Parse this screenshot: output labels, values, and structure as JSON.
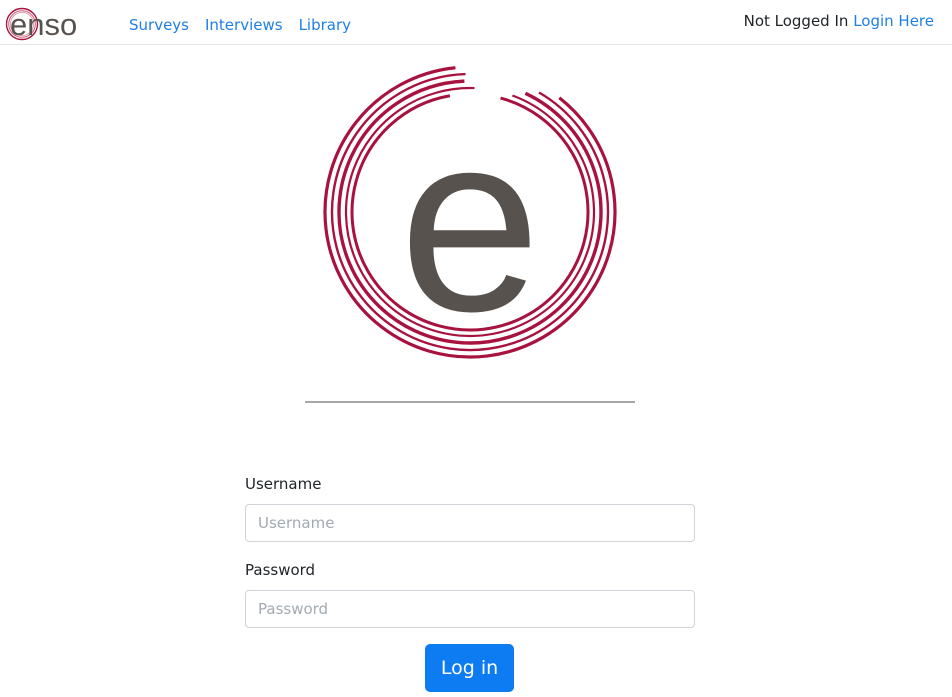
{
  "brand": {
    "name": "enso"
  },
  "nav": {
    "links": [
      {
        "label": "Surveys"
      },
      {
        "label": "Interviews"
      },
      {
        "label": "Library"
      }
    ],
    "status_text": "Not Logged In",
    "login_link": "Login Here"
  },
  "hero": {
    "logo_letter": "e"
  },
  "login_form": {
    "username_label": "Username",
    "username_placeholder": "Username",
    "username_value": "",
    "password_label": "Password",
    "password_placeholder": "Password",
    "password_value": "",
    "submit_label": "Log in"
  },
  "colors": {
    "brand_red": "#a8123e",
    "brand_gray": "#58524e",
    "link_blue": "#1f7fe5",
    "primary_button": "#0d7cf2"
  }
}
